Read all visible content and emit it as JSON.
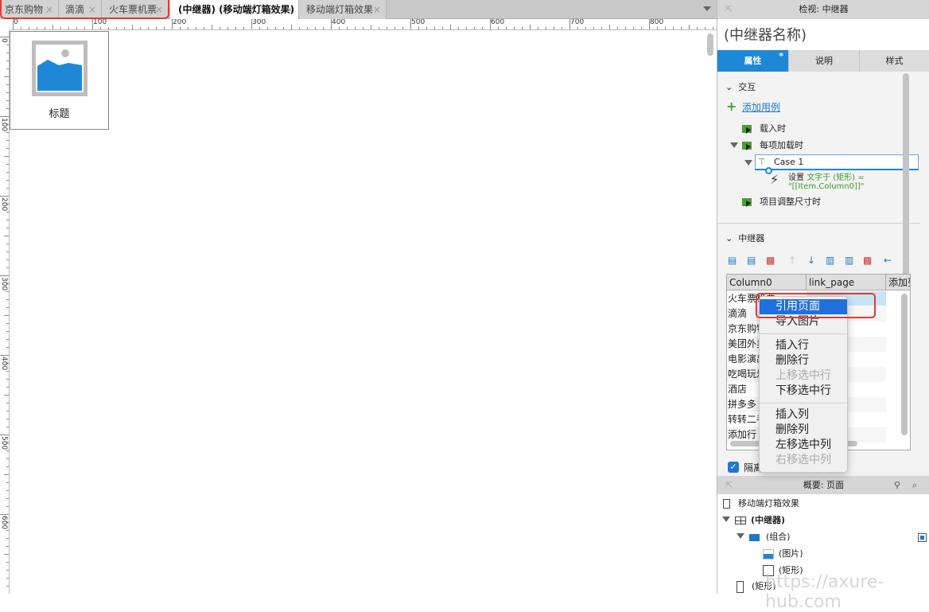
{
  "tabs": [
    {
      "label": "京东购物",
      "close": "×"
    },
    {
      "label": "滴滴",
      "close": "×"
    },
    {
      "label": "火车票机票",
      "close": "×"
    },
    {
      "label": "(中继器) (移动端灯箱效果)",
      "close": "×",
      "active": true
    },
    {
      "label": "移动端灯箱效果",
      "close": "×"
    }
  ],
  "ruler": {
    "top": [
      "0",
      "100",
      "200",
      "300",
      "400",
      "500",
      "600",
      "700",
      "800"
    ],
    "left": [
      "0",
      "100",
      "200",
      "300",
      "400",
      "500",
      "600"
    ]
  },
  "canvas": {
    "widget_label": "标题"
  },
  "inspector": {
    "header": "检视: 中继器",
    "name": "(中继器名称)",
    "tabs": [
      "属性",
      "说明",
      "样式"
    ],
    "tab_dot": "*",
    "interaction": {
      "title": "交互",
      "add_case": "添加用例",
      "events": [
        "载入时",
        "每项加载时",
        "项目调整尺寸时"
      ],
      "case": "Case 1",
      "action_prefix": "设置",
      "action_text": "文字于 (矩形) =",
      "action_value": "\"[[Item.Column0]]\""
    },
    "repeater": {
      "title": "中继器",
      "columns": [
        "Column0",
        "link_page",
        "添加列"
      ],
      "rows": [
        "火车票机票",
        "滴滴",
        "京东购物",
        "美团外卖",
        "电影演出",
        "吃喝玩乐",
        "酒店",
        "拼多多",
        "转转二手",
        "添加行"
      ],
      "isolate_label": "隔离",
      "isolate_checked": true
    },
    "context_menu": [
      {
        "label": "引用页面",
        "selected": true
      },
      {
        "label": "导入图片"
      },
      {
        "sep": true
      },
      {
        "label": "插入行"
      },
      {
        "label": "删除行"
      },
      {
        "label": "上移选中行",
        "disabled": true
      },
      {
        "label": "下移选中行"
      },
      {
        "sep": true
      },
      {
        "label": "插入列"
      },
      {
        "label": "删除列"
      },
      {
        "label": "左移选中列"
      },
      {
        "label": "右移选中列",
        "disabled": true
      }
    ]
  },
  "outline": {
    "header": "概要: 页面",
    "items": [
      {
        "label": "移动端灯箱效果",
        "icon": "page-icon"
      },
      {
        "label": "(中继器)",
        "icon": "repeater-icon"
      },
      {
        "label": "(组合)",
        "icon": "folder-icon"
      },
      {
        "label": "(图片)",
        "icon": "image-icon"
      },
      {
        "label": "(矩形)",
        "icon": "rectangle-icon"
      },
      {
        "label": "(矩形)",
        "icon": "rectangle-icon"
      }
    ]
  },
  "watermark": "https://axure-hub.com",
  "colors": {
    "accent": "#1e88d6",
    "highlight": "#e53b2c",
    "menu_selected": "#1f6fdc",
    "event_green": "#48a036"
  }
}
